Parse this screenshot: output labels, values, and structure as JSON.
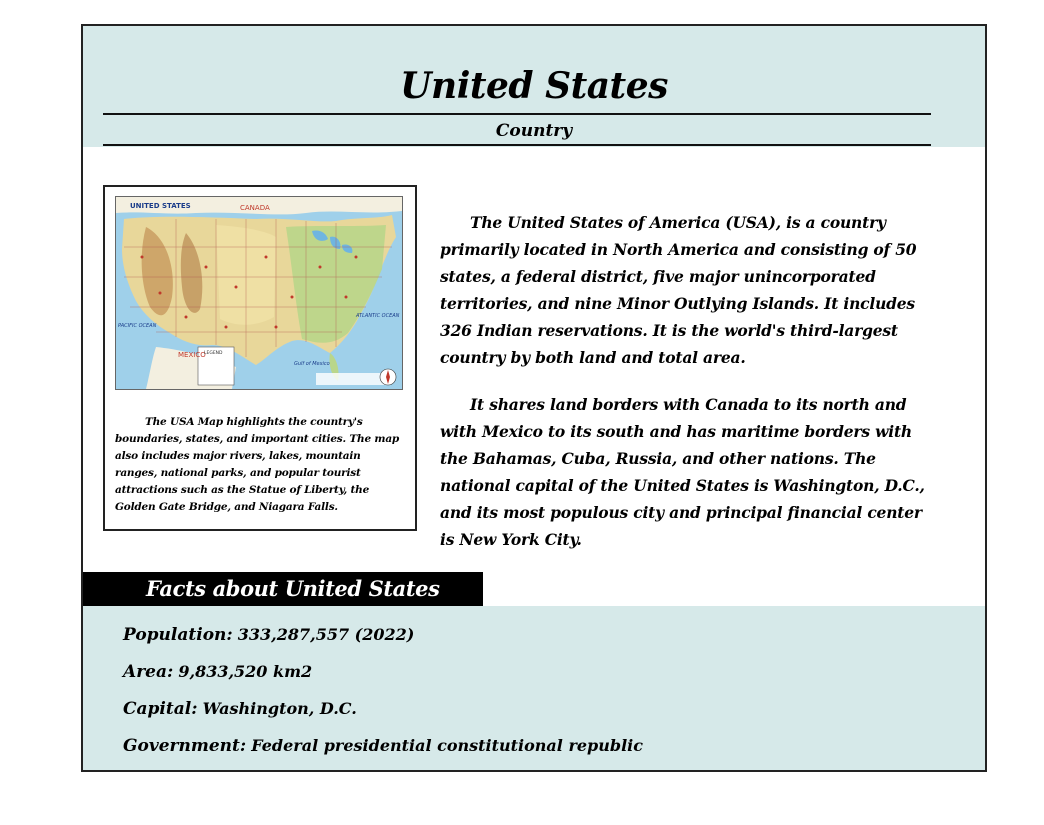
{
  "header": {
    "title": "United States",
    "subtitle": "Country"
  },
  "figure": {
    "map_labels": {
      "country": "UNITED STATES",
      "north": "CANADA",
      "south": "MEXICO",
      "pacific": "PACIFIC OCEAN",
      "atlantic": "ATLANTIC OCEAN",
      "gulf": "Gulf of Mexico",
      "legend": "LEGEND"
    },
    "caption": "The USA Map highlights the country's boundaries, states, and important cities. The map also includes major rivers, lakes, mountain ranges, national parks, and popular tourist attractions such as the Statue of Liberty, the Golden Gate Bridge, and Niagara Falls."
  },
  "body": {
    "paragraph_1": "The United States of America (USA), is a country primarily located in North America and consisting of 50 states, a federal district, five major unincorporated territories, and nine Minor Outlying Islands. It includes 326 Indian reservations. It is the world's third-largest country by both land and total area.",
    "paragraph_2": "It shares land borders with Canada to its north and with Mexico to its south and has maritime borders with the Bahamas, Cuba, Russia, and other nations. The national capital of the United States is Washington, D.C., and its most populous city and principal financial center is New York City."
  },
  "facts": {
    "heading": "Facts about United States",
    "population_label": "Population:",
    "population_value": "333,287,557 (2022)",
    "area_label": "Area:",
    "area_value": "9,833,520 km2",
    "capital_label": "Capital:",
    "capital_value": "Washington, D.C.",
    "government_label": "Government:",
    "government_value": "Federal presidential constitutional republic"
  },
  "colors": {
    "panel_background": "#d6e9e9",
    "facts_heading_background": "#000000"
  }
}
